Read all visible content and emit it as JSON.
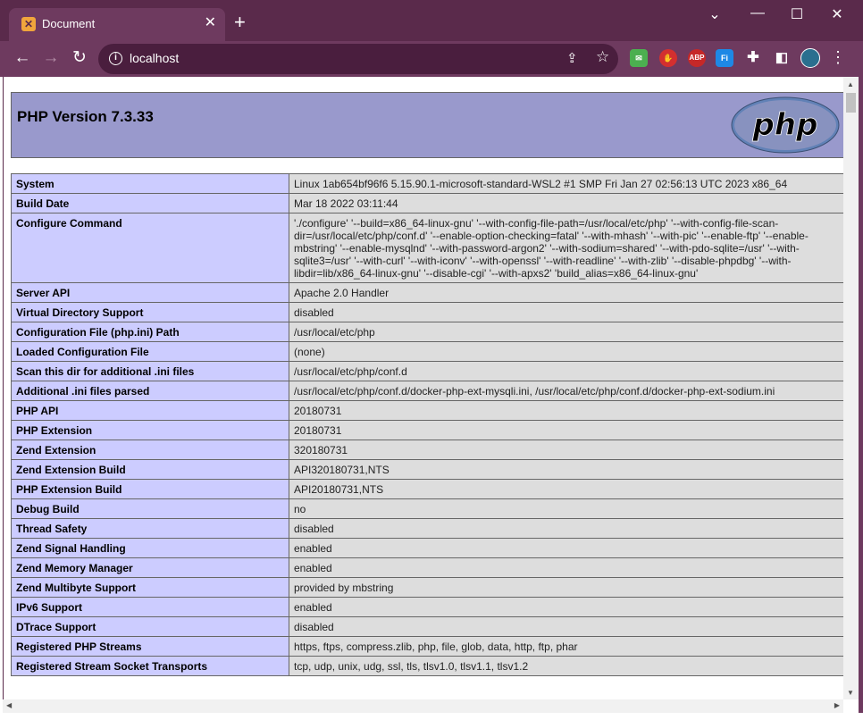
{
  "browser": {
    "tab_title": "Document",
    "tab_favicon": "xampp-icon",
    "url": "localhost",
    "accent_color": "#6e3a5f"
  },
  "page": {
    "title": "PHP Version 7.3.33",
    "logo_text": "php",
    "rows": [
      {
        "label": "System",
        "value": "Linux 1ab654bf96f6 5.15.90.1-microsoft-standard-WSL2 #1 SMP Fri Jan 27 02:56:13 UTC 2023 x86_64"
      },
      {
        "label": "Build Date",
        "value": "Mar 18 2022 03:11:44"
      },
      {
        "label": "Configure Command",
        "value": "'./configure' '--build=x86_64-linux-gnu' '--with-config-file-path=/usr/local/etc/php' '--with-config-file-scan-dir=/usr/local/etc/php/conf.d' '--enable-option-checking=fatal' '--with-mhash' '--with-pic' '--enable-ftp' '--enable-mbstring' '--enable-mysqlnd' '--with-password-argon2' '--with-sodium=shared' '--with-pdo-sqlite=/usr' '--with-sqlite3=/usr' '--with-curl' '--with-iconv' '--with-openssl' '--with-readline' '--with-zlib' '--disable-phpdbg' '--with-libdir=lib/x86_64-linux-gnu' '--disable-cgi' '--with-apxs2' 'build_alias=x86_64-linux-gnu'"
      },
      {
        "label": "Server API",
        "value": "Apache 2.0 Handler"
      },
      {
        "label": "Virtual Directory Support",
        "value": "disabled"
      },
      {
        "label": "Configuration File (php.ini) Path",
        "value": "/usr/local/etc/php"
      },
      {
        "label": "Loaded Configuration File",
        "value": "(none)"
      },
      {
        "label": "Scan this dir for additional .ini files",
        "value": "/usr/local/etc/php/conf.d"
      },
      {
        "label": "Additional .ini files parsed",
        "value": "/usr/local/etc/php/conf.d/docker-php-ext-mysqli.ini, /usr/local/etc/php/conf.d/docker-php-ext-sodium.ini"
      },
      {
        "label": "PHP API",
        "value": "20180731"
      },
      {
        "label": "PHP Extension",
        "value": "20180731"
      },
      {
        "label": "Zend Extension",
        "value": "320180731"
      },
      {
        "label": "Zend Extension Build",
        "value": "API320180731,NTS"
      },
      {
        "label": "PHP Extension Build",
        "value": "API20180731,NTS"
      },
      {
        "label": "Debug Build",
        "value": "no"
      },
      {
        "label": "Thread Safety",
        "value": "disabled"
      },
      {
        "label": "Zend Signal Handling",
        "value": "enabled"
      },
      {
        "label": "Zend Memory Manager",
        "value": "enabled"
      },
      {
        "label": "Zend Multibyte Support",
        "value": "provided by mbstring"
      },
      {
        "label": "IPv6 Support",
        "value": "enabled"
      },
      {
        "label": "DTrace Support",
        "value": "disabled"
      },
      {
        "label": "Registered PHP Streams",
        "value": "https, ftps, compress.zlib, php, file, glob, data, http, ftp, phar"
      },
      {
        "label": "Registered Stream Socket Transports",
        "value": "tcp, udp, unix, udg, ssl, tls, tlsv1.0, tlsv1.1, tlsv1.2"
      }
    ]
  }
}
